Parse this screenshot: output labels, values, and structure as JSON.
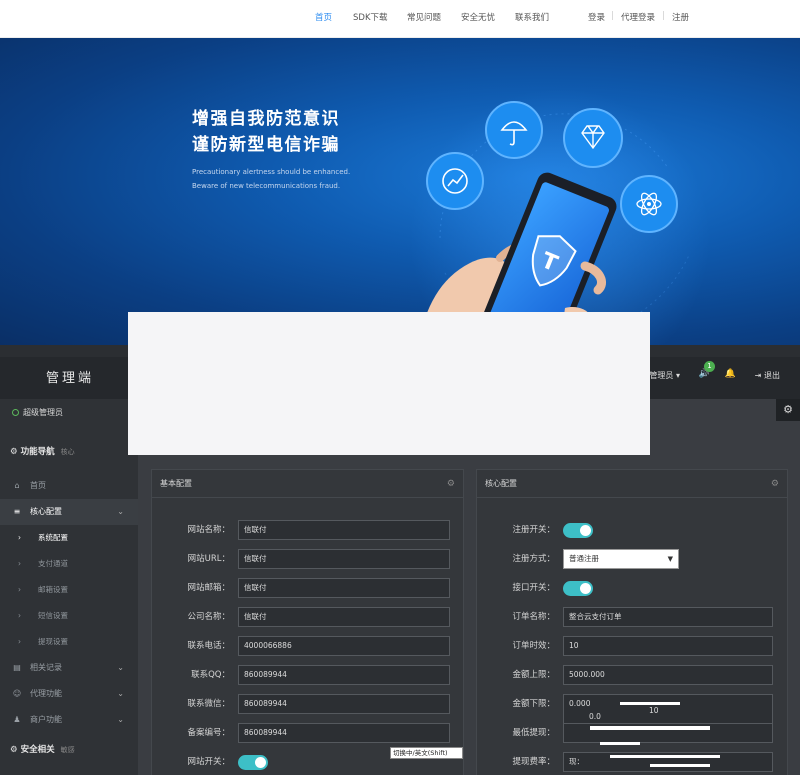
{
  "topnav": {
    "home": "首页",
    "sdk": "SDK下载",
    "faq": "常见问题",
    "security": "安全无忧",
    "contact": "联系我们",
    "login": "登录",
    "agent_login": "代理登录",
    "register": "注册"
  },
  "banner": {
    "line1": "增强自我防范意识",
    "line2": "谨防新型电信诈骗",
    "sub1": "Precautionary alertness should be enhanced.",
    "sub2": "Beware of new telecommunications fraud."
  },
  "admin": {
    "logo": "管理端",
    "user_menu": "管理员",
    "notif_count": "1",
    "logout": "退出",
    "role": "超级管理员",
    "nav_group_1": "功能导航",
    "nav_group_1_tag": "核心",
    "nav_group_2": "安全相关",
    "nav_group_2_tag": "敏感",
    "sidebar": {
      "home": "首页",
      "core_config": "核心配置",
      "sub_items": [
        "系统配置",
        "支付通道",
        "邮箱设置",
        "短信设置",
        "提现设置"
      ],
      "records": "相关记录",
      "agent": "代理功能",
      "merchant": "商户功能"
    }
  },
  "basic_config": {
    "title": "基本配置",
    "fields": [
      {
        "label": "网站名称：",
        "value": "信联付"
      },
      {
        "label": "网站URL：",
        "value": "信联付"
      },
      {
        "label": "网站邮箱：",
        "value": "信联付"
      },
      {
        "label": "公司名称：",
        "value": "信联付"
      },
      {
        "label": "联系电话：",
        "value": "4000066886"
      },
      {
        "label": "联系QQ：",
        "value": "860089944"
      },
      {
        "label": "联系微信：",
        "value": "860089944"
      },
      {
        "label": "备案编号：",
        "value": "860089944"
      }
    ],
    "switch_label": "网站开关："
  },
  "core_config": {
    "title": "核心配置",
    "register_switch": "注册开关：",
    "register_mode": "注册方式：",
    "register_mode_value": "普通注册",
    "api_switch": "接口开关：",
    "order_name": "订单名称：",
    "order_name_value": "整合云支付订单",
    "order_timeout": "订单时效：",
    "order_timeout_value": "10",
    "amount_max": "金额上限：",
    "amount_max_value": "5000.000",
    "amount_min": "金额下限：",
    "amount_min_value": "0.000",
    "min_withdraw": "最低提现：",
    "withdraw_fee": "提现费率：",
    "overlap_a": "0.0",
    "overlap_b": "10",
    "withdraw_partial": "现："
  },
  "ime_hint": "切换中/英文(Shift)",
  "colors": {
    "accent": "#2d8cf0",
    "toggle_on": "#3dbfc7",
    "status_online": "#5cb85c",
    "badge": "#4caf50"
  }
}
